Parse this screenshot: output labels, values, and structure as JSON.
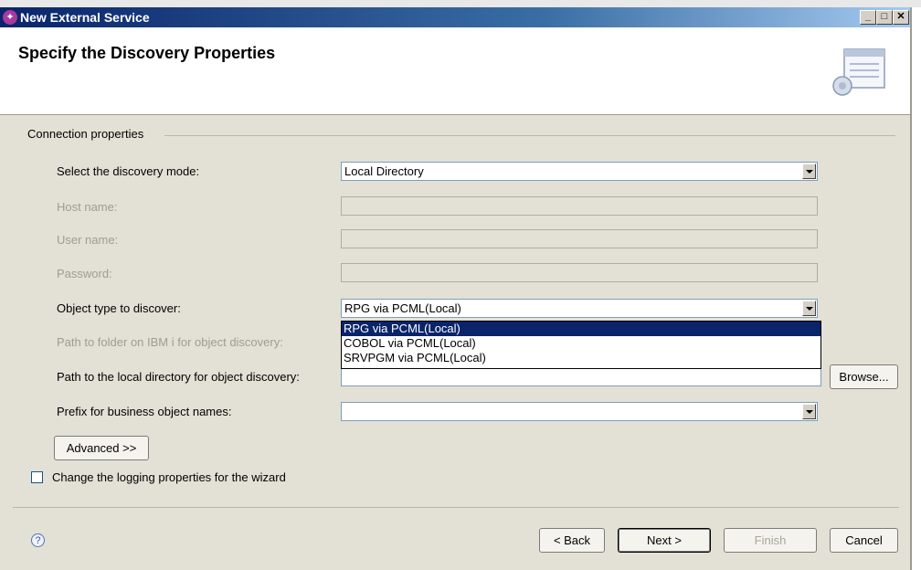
{
  "window": {
    "title": "New External Service",
    "app_icon_glyph": "✦",
    "minimize_glyph": "_",
    "maximize_glyph": "□",
    "close_glyph": "✕"
  },
  "header": {
    "title": "Specify the Discovery Properties"
  },
  "connection": {
    "group_label": "Connection properties",
    "discovery_mode": {
      "label": "Select the discovery mode:",
      "value": "Local Directory"
    },
    "host_name": {
      "label": "Host name:",
      "value": ""
    },
    "user_name": {
      "label": "User name:",
      "value": ""
    },
    "password": {
      "label": "Password:",
      "value": ""
    },
    "object_type": {
      "label": "Object type to discover:",
      "value": "RPG via PCML(Local)",
      "options": [
        "RPG via PCML(Local)",
        "COBOL via PCML(Local)",
        "SRVPGM via PCML(Local)"
      ],
      "selected_option": "RPG via PCML(Local)"
    },
    "ibm_i_path": {
      "label": "Path to folder on IBM i for object discovery:",
      "value": ""
    },
    "local_path": {
      "label": "Path to the local directory for object discovery:",
      "value": "",
      "browse_label": "Browse..."
    },
    "prefix": {
      "label": "Prefix for business object names:",
      "value": ""
    },
    "advanced_label": "Advanced >>"
  },
  "logging": {
    "label": "Change the logging properties for the wizard",
    "checked": false
  },
  "footer": {
    "help_glyph": "?",
    "back_label": "< Back",
    "next_label": "Next >",
    "finish_label": "Finish",
    "cancel_label": "Cancel"
  },
  "icons": [
    "app-icon",
    "minimize-icon",
    "maximize-icon",
    "close-icon",
    "wizard-banner-icon",
    "chevron-down-icon",
    "help-icon"
  ]
}
